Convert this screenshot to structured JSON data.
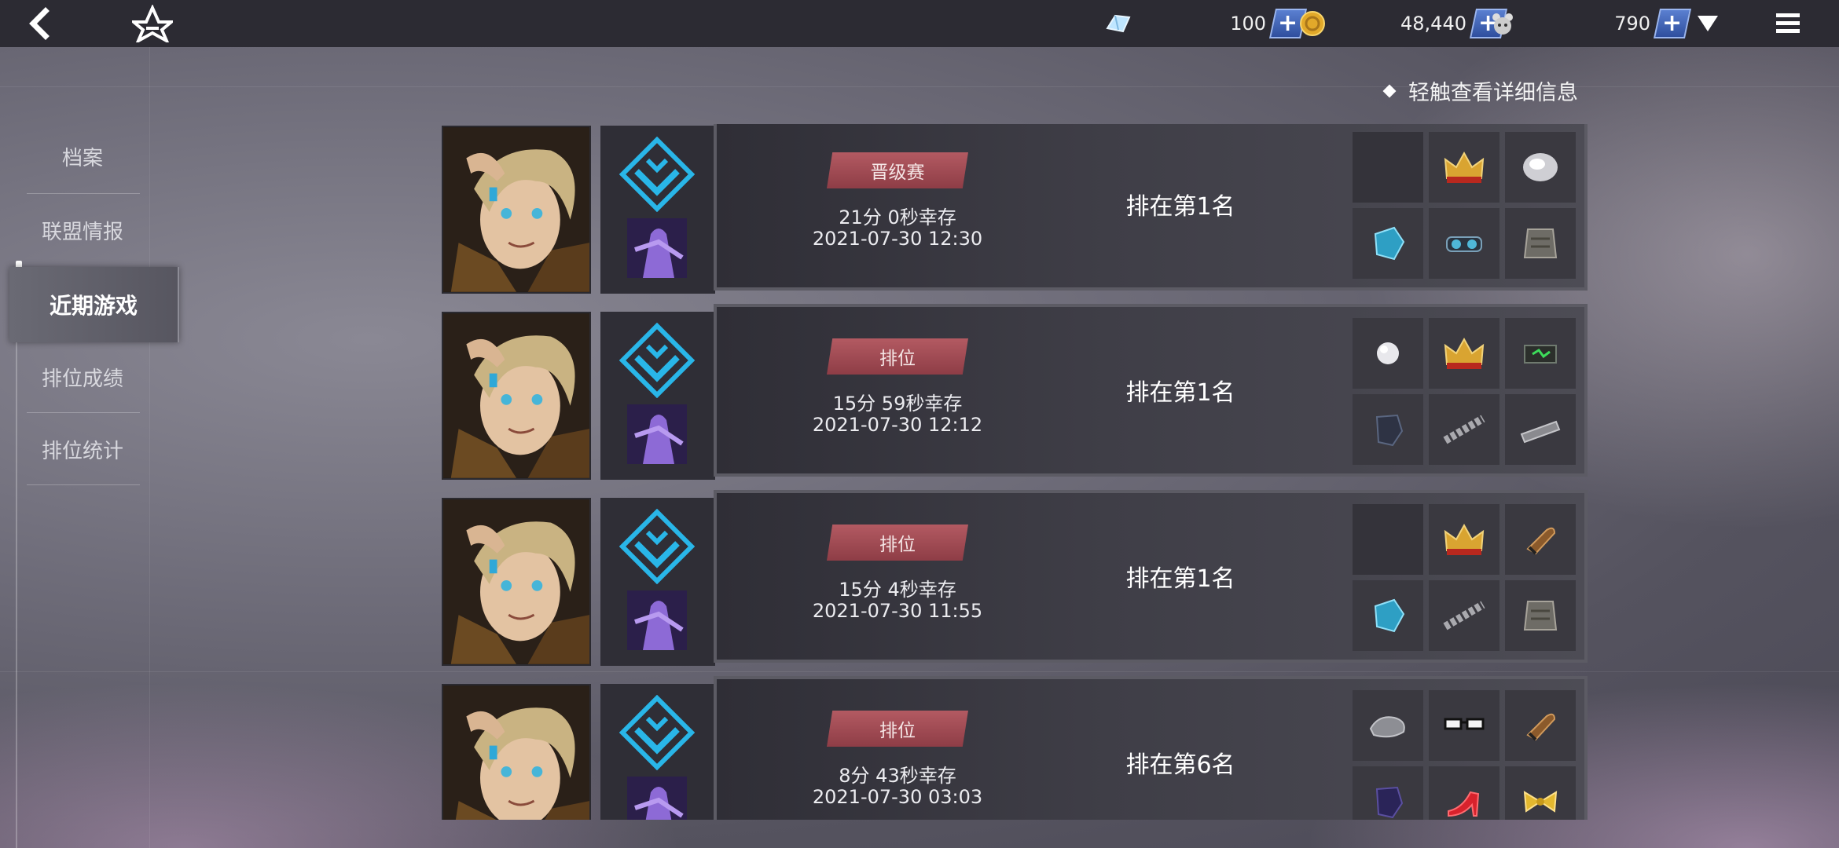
{
  "topbar": {
    "resources": [
      {
        "icon": "crystal-icon",
        "value": "100"
      },
      {
        "icon": "gold-coin-icon",
        "value": "48,440"
      },
      {
        "icon": "bear-token-icon",
        "value": "790"
      }
    ]
  },
  "hint": {
    "text": "轻触查看详细信息"
  },
  "sidebar": {
    "items": [
      {
        "label": "档案",
        "active": false
      },
      {
        "label": "联盟情报",
        "active": false
      },
      {
        "label": "近期游戏",
        "active": true
      },
      {
        "label": "排位成绩",
        "active": false
      },
      {
        "label": "排位统计",
        "active": false
      }
    ]
  },
  "games": [
    {
      "mode": "晋级赛",
      "survival": "21分 0秒幸存",
      "datetime": "2021-07-30 12:30",
      "placement": "排在第1名",
      "items": [
        "empty",
        "crown-icon",
        "disc-icon",
        "blue-armor-icon",
        "goggles-icon",
        "vest-icon"
      ]
    },
    {
      "mode": "排位",
      "survival": "15分 59秒幸存",
      "datetime": "2021-07-30 12:12",
      "placement": "排在第1名",
      "items": [
        "pearl-icon",
        "crown-icon",
        "green-chip-icon",
        "dark-armor-icon",
        "chain-icon",
        "ammo-clip-icon"
      ]
    },
    {
      "mode": "排位",
      "survival": "15分 4秒幸存",
      "datetime": "2021-07-30 11:55",
      "placement": "排在第1名",
      "items": [
        "empty",
        "crown-icon",
        "bullet-icon",
        "blue-armor-icon",
        "chain-icon",
        "vest-icon"
      ]
    },
    {
      "mode": "排位",
      "survival": "8分 43秒幸存",
      "datetime": "2021-07-30 03:03",
      "placement": "排在第6名",
      "items": [
        "stone-icon",
        "glasses-icon",
        "bullet-icon",
        "dark-armor-icon",
        "red-heel-icon",
        "gold-bow-icon"
      ]
    }
  ],
  "colors": {
    "topbar": "#2c2b33",
    "accent_plus": "#3f62b8",
    "badge": "#9e4650",
    "rank_icon": "#29b6e8",
    "crown_gold": "#d9a431"
  }
}
